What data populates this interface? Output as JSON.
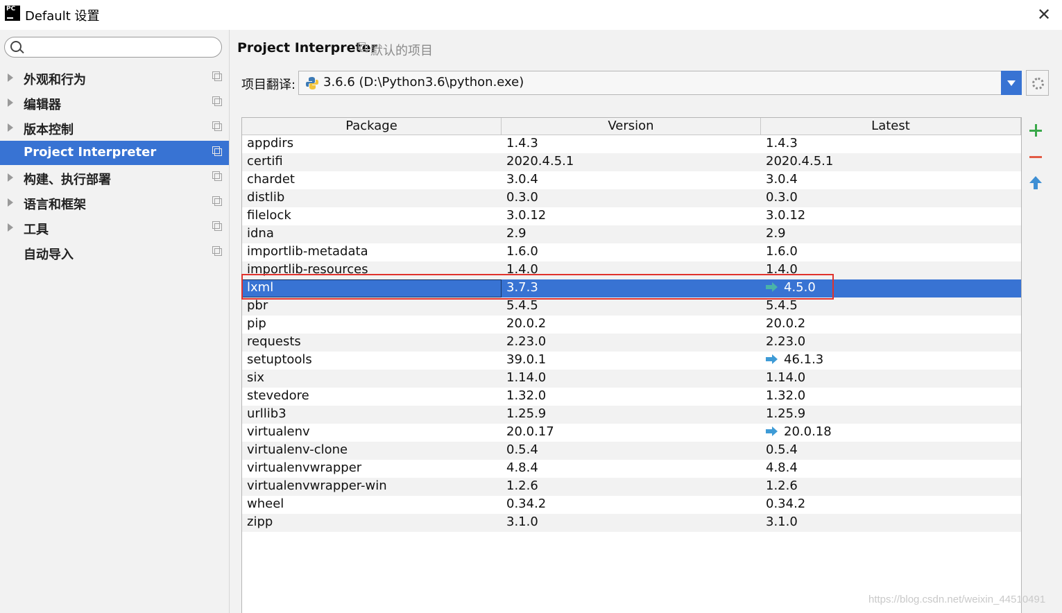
{
  "window": {
    "logo_text": "PC",
    "title": "Default 设置",
    "close_label": "✕"
  },
  "sidebar": {
    "search_placeholder": "",
    "items": [
      {
        "label": "外观和行为",
        "expandable": true,
        "selected": false
      },
      {
        "label": "编辑器",
        "expandable": true,
        "selected": false
      },
      {
        "label": "版本控制",
        "expandable": true,
        "selected": false
      },
      {
        "label": "Project Interpreter",
        "expandable": false,
        "selected": true
      },
      {
        "label": "构建、执行部署",
        "expandable": true,
        "selected": false
      },
      {
        "label": "语言和框架",
        "expandable": true,
        "selected": false
      },
      {
        "label": "工具",
        "expandable": true,
        "selected": false
      },
      {
        "label": "自动导入",
        "expandable": false,
        "selected": false
      }
    ]
  },
  "main": {
    "title": "Project Interpreter",
    "subtitle": "默认的项目",
    "interpreter_label": "项目翻译:",
    "interpreter_value": "3.6.6 (D:\\Python3.6\\python.exe)"
  },
  "table": {
    "headers": [
      "Package",
      "Version",
      "Latest"
    ],
    "selected_index": 8,
    "rows": [
      {
        "package": "appdirs",
        "version": "1.4.3",
        "latest": "1.4.3",
        "upgrade": false
      },
      {
        "package": "certifi",
        "version": "2020.4.5.1",
        "latest": "2020.4.5.1",
        "upgrade": false
      },
      {
        "package": "chardet",
        "version": "3.0.4",
        "latest": "3.0.4",
        "upgrade": false
      },
      {
        "package": "distlib",
        "version": "0.3.0",
        "latest": "0.3.0",
        "upgrade": false
      },
      {
        "package": "filelock",
        "version": "3.0.12",
        "latest": "3.0.12",
        "upgrade": false
      },
      {
        "package": "idna",
        "version": "2.9",
        "latest": "2.9",
        "upgrade": false
      },
      {
        "package": "importlib-metadata",
        "version": "1.6.0",
        "latest": "1.6.0",
        "upgrade": false
      },
      {
        "package": "importlib-resources",
        "version": "1.4.0",
        "latest": "1.4.0",
        "upgrade": false
      },
      {
        "package": "lxml",
        "version": "3.7.3",
        "latest": "4.5.0",
        "upgrade": true
      },
      {
        "package": "pbr",
        "version": "5.4.5",
        "latest": "5.4.5",
        "upgrade": false
      },
      {
        "package": "pip",
        "version": "20.0.2",
        "latest": "20.0.2",
        "upgrade": false
      },
      {
        "package": "requests",
        "version": "2.23.0",
        "latest": "2.23.0",
        "upgrade": false
      },
      {
        "package": "setuptools",
        "version": "39.0.1",
        "latest": "46.1.3",
        "upgrade": true
      },
      {
        "package": "six",
        "version": "1.14.0",
        "latest": "1.14.0",
        "upgrade": false
      },
      {
        "package": "stevedore",
        "version": "1.32.0",
        "latest": "1.32.0",
        "upgrade": false
      },
      {
        "package": "urllib3",
        "version": "1.25.9",
        "latest": "1.25.9",
        "upgrade": false
      },
      {
        "package": "virtualenv",
        "version": "20.0.17",
        "latest": "20.0.18",
        "upgrade": true
      },
      {
        "package": "virtualenv-clone",
        "version": "0.5.4",
        "latest": "0.5.4",
        "upgrade": false
      },
      {
        "package": "virtualenvwrapper",
        "version": "4.8.4",
        "latest": "4.8.4",
        "upgrade": false
      },
      {
        "package": "virtualenvwrapper-win",
        "version": "1.2.6",
        "latest": "1.2.6",
        "upgrade": false
      },
      {
        "package": "wheel",
        "version": "0.34.2",
        "latest": "0.34.2",
        "upgrade": false
      },
      {
        "package": "zipp",
        "version": "3.1.0",
        "latest": "3.1.0",
        "upgrade": false
      }
    ]
  },
  "icons": {
    "add": "plus-icon",
    "remove": "minus-icon",
    "upgrade": "upgrade-arrow-icon",
    "settings": "gear-icon",
    "search": "search-icon"
  },
  "colors": {
    "selection": "#3873d3",
    "add": "#3aa84a",
    "remove": "#e25b45",
    "upgrade": "#3e8fd4",
    "highlight": "#e0322c"
  },
  "watermark": "https://blog.csdn.net/weixin_44510491"
}
